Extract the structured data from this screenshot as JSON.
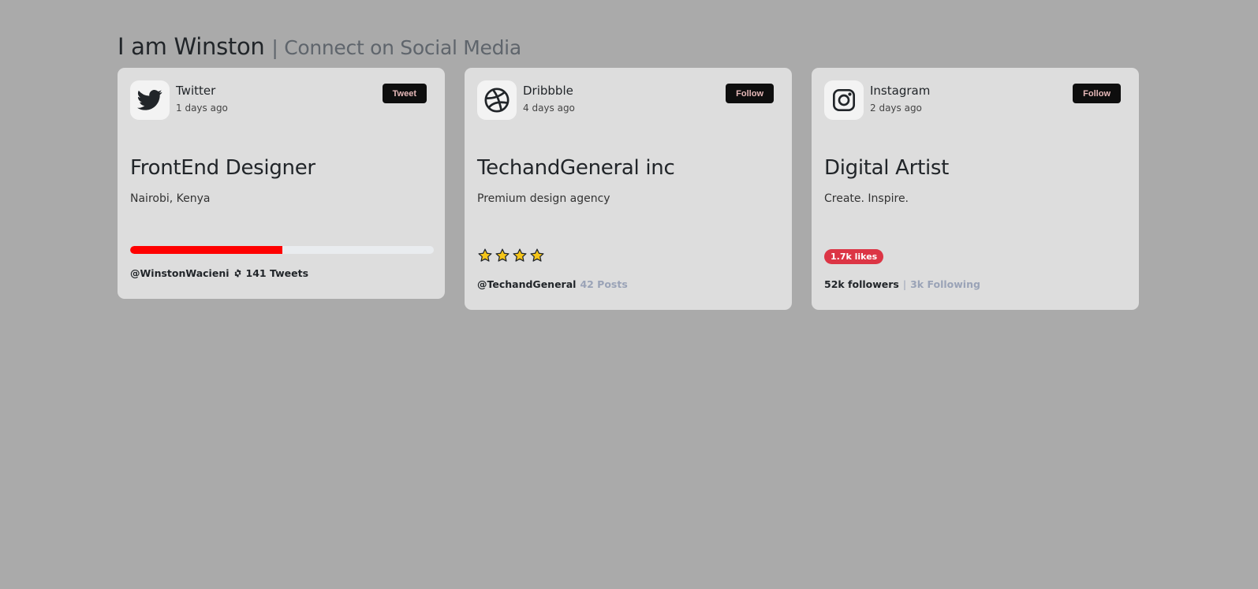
{
  "header": {
    "name": "I am Winston",
    "tagline": "| Connect on Social Media"
  },
  "cards": [
    {
      "platform": "Twitter",
      "icon": "twitter-bird-icon",
      "time_ago": "1 days ago",
      "button_label": "Tweet",
      "title": "FrontEnd Designer",
      "subtitle": "Nairobi, Kenya",
      "progress_percent": 50,
      "progress_color": "#ff0000",
      "handle": "@WinstonWacieni",
      "badge_icon": "gear-icon",
      "count_text": "141 Tweets"
    },
    {
      "platform": "Dribbble",
      "icon": "dribbble-ball-icon",
      "time_ago": "4 days ago",
      "button_label": "Follow",
      "title": "TechandGeneral inc",
      "subtitle": "Premium design agency",
      "rating": 4,
      "star_color": "#f5c518",
      "handle": "@TechandGeneral",
      "count_text": "42 Posts"
    },
    {
      "platform": "Instagram",
      "icon": "instagram-camera-icon",
      "time_ago": "2 days ago",
      "button_label": "Follow",
      "title": "Digital Artist",
      "subtitle": "Create. Inspire.",
      "likes_badge": "1.7k likes",
      "likes_badge_color": "#dc3545",
      "followers_text": "52k followers",
      "separator": "|",
      "following_text": "3k Following"
    }
  ]
}
